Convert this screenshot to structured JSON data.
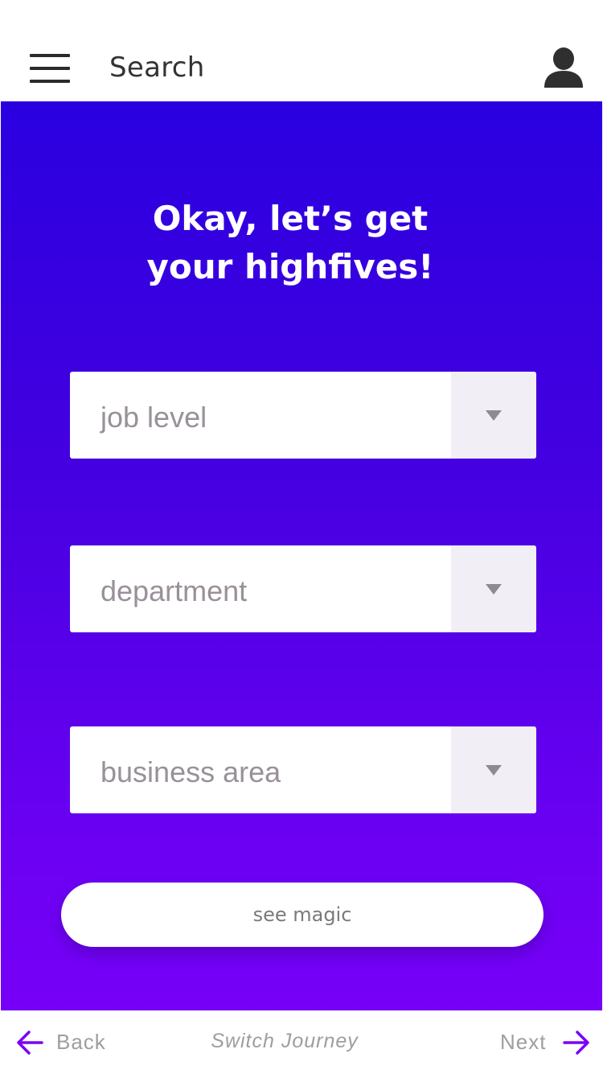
{
  "header": {
    "title": "Search",
    "menu_icon": "hamburger-menu-icon",
    "profile_icon": "user-avatar-icon"
  },
  "hero": {
    "headline_line1": "Okay, let’s get",
    "headline_line2": "your highfives!"
  },
  "form": {
    "job_level": {
      "placeholder": "job level"
    },
    "department": {
      "placeholder": "department"
    },
    "business_area": {
      "placeholder": "business area"
    },
    "submit_label": "see magic"
  },
  "footer": {
    "back_label": "Back",
    "switch_label": "Switch Journey",
    "next_label": "Next"
  },
  "colors": {
    "gradient_top": "#2a00e0",
    "gradient_bottom": "#7700f7",
    "accent": "#7a00f5",
    "muted_text": "#9e9e9e"
  }
}
